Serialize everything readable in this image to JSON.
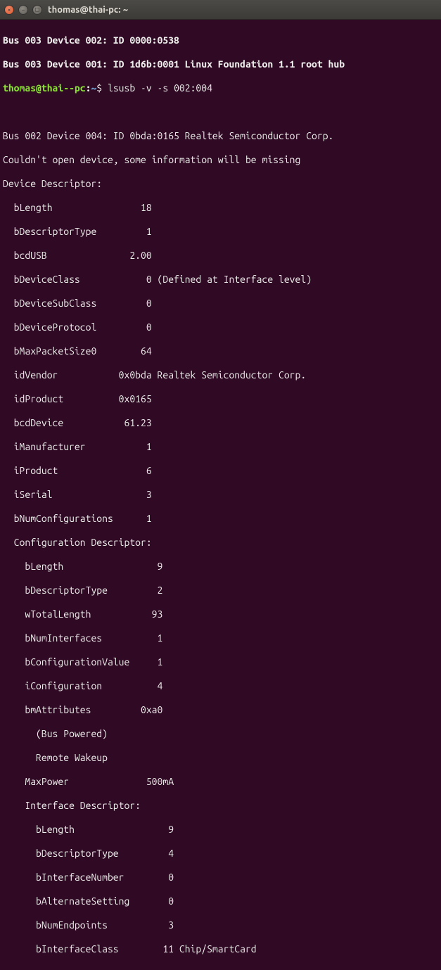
{
  "window": {
    "title": "thomas@thai-pc: ~"
  },
  "prompt": {
    "user_host": "thomas@thai--pc",
    "sep": ":",
    "path": "~",
    "dollar": "$",
    "command": "lsusb -v -s 002:004"
  },
  "pre_lines": [
    "Bus 003 Device 002: ID 0000:0538",
    "Bus 003 Device 001: ID 1d6b:0001 Linux Foundation 1.1 root hub"
  ],
  "out": {
    "blank0": "",
    "dev_header": "Bus 002 Device 004: ID 0bda:0165 Realtek Semiconductor Corp.",
    "warn": "Couldn't open device, some information will be missing",
    "dd_label": "Device Descriptor:",
    "bLength": "  bLength                18",
    "bDescriptorType": "  bDescriptorType         1",
    "bcdUSB": "  bcdUSB               2.00",
    "bDeviceClass": "  bDeviceClass            0 (Defined at Interface level)",
    "bDeviceSubClass": "  bDeviceSubClass         0",
    "bDeviceProtocol": "  bDeviceProtocol         0",
    "bMaxPacketSize0": "  bMaxPacketSize0        64",
    "idVendor": "  idVendor           0x0bda Realtek Semiconductor Corp.",
    "idProduct": "  idProduct          0x0165",
    "bcdDevice": "  bcdDevice           61.23",
    "iManufacturer": "  iManufacturer           1",
    "iProduct": "  iProduct                6",
    "iSerial": "  iSerial                 3",
    "bNumConfigurations": "  bNumConfigurations      1",
    "cfg_label": "  Configuration Descriptor:",
    "c_bLength": "    bLength                 9",
    "c_bDescriptorType": "    bDescriptorType         2",
    "c_wTotalLength": "    wTotalLength           93",
    "c_bNumInterfaces": "    bNumInterfaces          1",
    "c_bConfigValue": "    bConfigurationValue     1",
    "c_iConfiguration": "    iConfiguration          4",
    "c_bmAttributes": "    bmAttributes         0xa0",
    "c_buspowered": "      (Bus Powered)",
    "c_remotewakeup": "      Remote Wakeup",
    "c_MaxPower": "    MaxPower              500mA",
    "if_label": "    Interface Descriptor:",
    "i_bLength": "      bLength                 9",
    "i_bDescriptorType": "      bDescriptorType         4",
    "i_bInterfaceNumber": "      bInterfaceNumber        0",
    "i_bAlternate": "      bAlternateSetting       0",
    "i_bNumEndpoints": "      bNumEndpoints           3",
    "i_bInterfaceClass": "      bInterfaceClass        11 Chip/SmartCard"
  }
}
